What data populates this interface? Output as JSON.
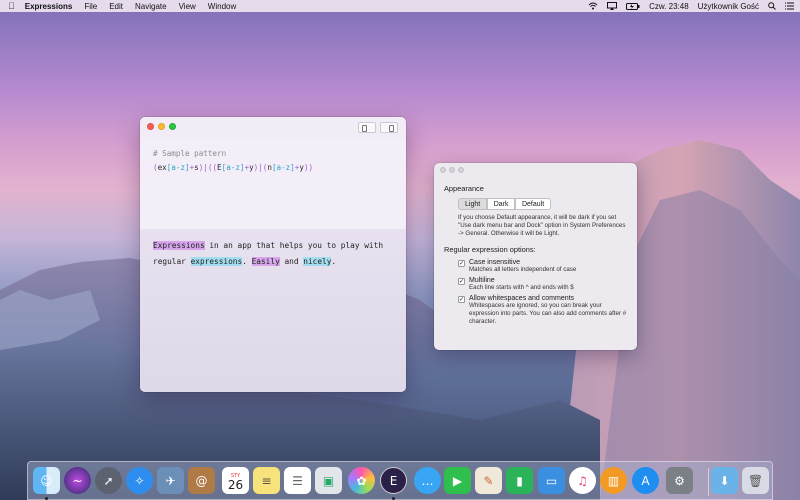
{
  "menubar": {
    "app": "Expressions",
    "items": [
      "File",
      "Edit",
      "Navigate",
      "View",
      "Window"
    ],
    "clock": "Czw. 23:48",
    "user": "Użytkownik Gość"
  },
  "main_window": {
    "pattern_comment": "# Sample pattern",
    "pattern": "(ex[a-z]+s)|((E[a-z]+y)|(n[a-z]+y))",
    "text_segments": [
      {
        "text": "Expressions",
        "hl": "purple"
      },
      {
        "text": " in an app that helps you to play with",
        "hl": ""
      },
      {
        "text": "regular ",
        "hl": ""
      },
      {
        "text": "expressions",
        "hl": "cyan"
      },
      {
        "text": ". ",
        "hl": ""
      },
      {
        "text": "Easily",
        "hl": "purple"
      },
      {
        "text": " and ",
        "hl": ""
      },
      {
        "text": "nicely",
        "hl": "cyan"
      },
      {
        "text": ".",
        "hl": ""
      }
    ]
  },
  "prefs": {
    "appearance_title": "Appearance",
    "appearance_options": [
      "Light",
      "Dark",
      "Default"
    ],
    "appearance_selected": "Light",
    "appearance_note": "If you choose Default appearance, it will be dark if you set \"Use dark menu bar and Dock\" option in System Preferences -> General. Otherwise it will be Light.",
    "regex_title": "Regular expression options:",
    "options": [
      {
        "label": "Case insensitive",
        "desc": "Matches all letters independent of case",
        "checked": true
      },
      {
        "label": "Multiline",
        "desc": "Each line starts with ^ and ends with $",
        "checked": true
      },
      {
        "label": "Allow whitespaces and comments",
        "desc": "Whitespaces are ignored, so you can break your expression into parts. You can also add comments after # character.",
        "checked": true
      }
    ]
  },
  "dock": {
    "calendar_day": "26",
    "calendar_month": "STY",
    "apps": [
      "Finder",
      "Siri",
      "Launchpad",
      "Safari",
      "Photo Booth",
      "Contacts",
      "Calendar",
      "Notes",
      "Reminders",
      "Preview",
      "Photos",
      "Expressions",
      "Messages",
      "FaceTime",
      "Numbers",
      "Keynote",
      "Pages",
      "iTunes",
      "iBooks",
      "App Store",
      "System Preferences",
      "Downloads",
      "Trash"
    ]
  }
}
